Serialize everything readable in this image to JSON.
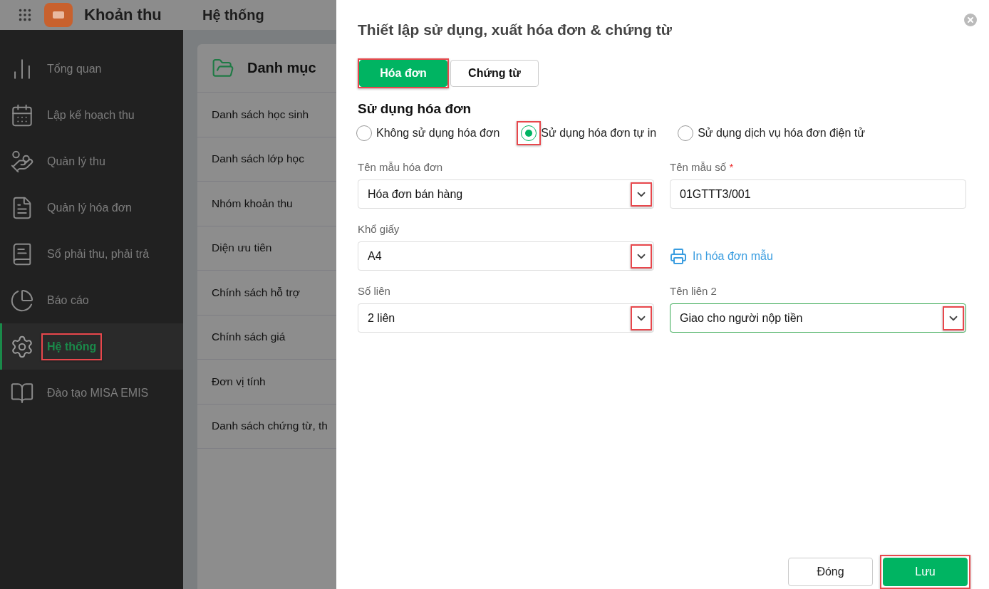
{
  "app": {
    "title": "Khoản thu",
    "section": "Hệ thống"
  },
  "sidebar": {
    "items": [
      {
        "label": "Tổng quan",
        "selected": false,
        "highlighted": false
      },
      {
        "label": "Lập kế hoạch thu",
        "selected": false,
        "highlighted": false
      },
      {
        "label": "Quản lý thu",
        "selected": false,
        "highlighted": false
      },
      {
        "label": "Quản lý hóa đơn",
        "selected": false,
        "highlighted": false
      },
      {
        "label": "Sổ phải thu, phải trả",
        "selected": false,
        "highlighted": false
      },
      {
        "label": "Báo cáo",
        "selected": false,
        "highlighted": false
      },
      {
        "label": "Hệ thống",
        "selected": true,
        "highlighted": true
      },
      {
        "label": "Đào tạo MISA EMIS",
        "selected": false,
        "highlighted": false
      }
    ]
  },
  "catalog": {
    "title": "Danh mục",
    "items": [
      "Danh sách học sinh",
      "Danh sách lớp học",
      "Nhóm khoản thu",
      "Diện ưu tiên",
      "Chính sách hỗ trợ",
      "Chính sách giá",
      "Đơn vị tính",
      "Danh sách chứng từ, th"
    ]
  },
  "dialog": {
    "title": "Thiết lập sử dụng, xuất hóa đơn & chứng từ",
    "tabs": [
      {
        "label": "Hóa đơn",
        "selected": true,
        "highlighted": true
      },
      {
        "label": "Chứng từ",
        "selected": false,
        "highlighted": false
      }
    ],
    "section_title": "Sử dụng hóa đơn",
    "radios": [
      {
        "label": "Không sử dụng hóa đơn",
        "selected": false,
        "highlighted": false
      },
      {
        "label": "Sử dụng hóa đơn tự in",
        "selected": true,
        "highlighted": true
      },
      {
        "label": "Sử dụng dịch vụ hóa đơn điện tử",
        "selected": false,
        "highlighted": false
      }
    ],
    "fields": [
      {
        "kind": "select",
        "label": "Tên mẫu hóa đơn",
        "value": "Hóa đơn bán hàng",
        "highlighted": true,
        "focused": false
      },
      {
        "kind": "input",
        "label": "Tên mẫu số",
        "required_mark": "*",
        "value": "01GTTT3/001",
        "focused": false
      },
      {
        "kind": "select",
        "label": "Khổ giấy",
        "value": "A4",
        "highlighted": true,
        "focused": false
      },
      {
        "kind": "link",
        "value": "In hóa đơn mẫu"
      },
      {
        "kind": "select",
        "label": "Số liên",
        "value": "2 liên",
        "highlighted": true,
        "focused": false
      },
      {
        "kind": "select",
        "label": "Tên liên 2",
        "value": "Giao cho người nộp tiền",
        "highlighted": true,
        "focused": true
      }
    ],
    "buttons": [
      {
        "label": "Đóng",
        "kind": "secondary",
        "highlighted": false
      },
      {
        "label": "Lưu",
        "kind": "primary",
        "highlighted": true
      }
    ]
  }
}
